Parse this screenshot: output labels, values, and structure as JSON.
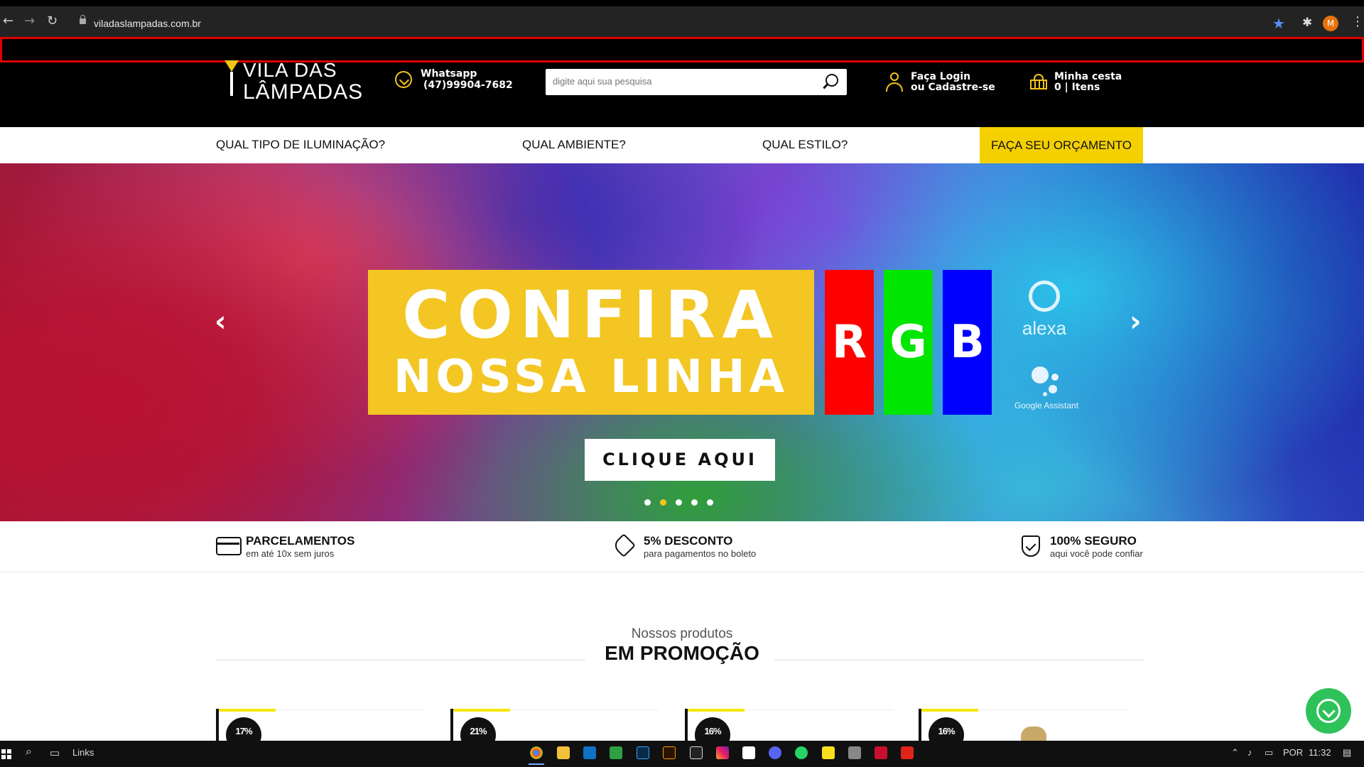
{
  "browser": {
    "url": "viladaslampadas.com.br",
    "back_icon": "back-arrow-icon",
    "forward_icon": "forward-arrow-icon",
    "reload_icon": "reload-icon",
    "profile_initial": "M"
  },
  "header": {
    "logo_line1": "VILA DAS",
    "logo_line2": "LÂMPADAS",
    "whatsapp_label": "Whatsapp",
    "whatsapp_phone": "(47)99904-7682",
    "search_placeholder": "digite aqui sua pesquisa",
    "login_line1": "Faça Login",
    "login_line2": "ou Cadastre-se",
    "cart_line1": "Minha cesta",
    "cart_line2": "0 | Itens",
    "accent_color": "#f5c518"
  },
  "menu": {
    "items": [
      {
        "label": "QUAL TIPO DE ILUMINAÇÃO?"
      },
      {
        "label": "QUAL AMBIENTE?"
      },
      {
        "label": "QUAL ESTILO?"
      }
    ],
    "cta": "FAÇA SEU ORÇAMENTO",
    "cta_color": "#f5d000"
  },
  "hero": {
    "line1": "CONFIRA",
    "line2": "NOSSA LINHA",
    "rgb": [
      "R",
      "G",
      "B"
    ],
    "rgb_colors": [
      "#ff0000",
      "#00e600",
      "#0000ff"
    ],
    "alexa_label": "alexa",
    "assistant_label": "Google Assistant",
    "button": "CLIQUE AQUI",
    "prev": "‹",
    "next": "›",
    "slides": 5,
    "active_slide": 2
  },
  "features": [
    {
      "title": "PARCELAMENTOS",
      "subtitle": "em até 10x sem juros",
      "icon": "credit-card-icon"
    },
    {
      "title": "5% DESCONTO",
      "subtitle": "para pagamentos no boleto",
      "icon": "tag-icon"
    },
    {
      "title": "100% SEGURO",
      "subtitle": "aqui você pode confiar",
      "icon": "shield-check-icon"
    }
  ],
  "section": {
    "subtitle": "Nossos produtos",
    "title": "EM PROMOÇÃO"
  },
  "products": [
    {
      "badge": "17%"
    },
    {
      "badge": "21%"
    },
    {
      "badge": "16%"
    },
    {
      "badge": "16%"
    }
  ],
  "taskbar": {
    "links_label": "Links",
    "language": "POR",
    "time": "11:32"
  }
}
